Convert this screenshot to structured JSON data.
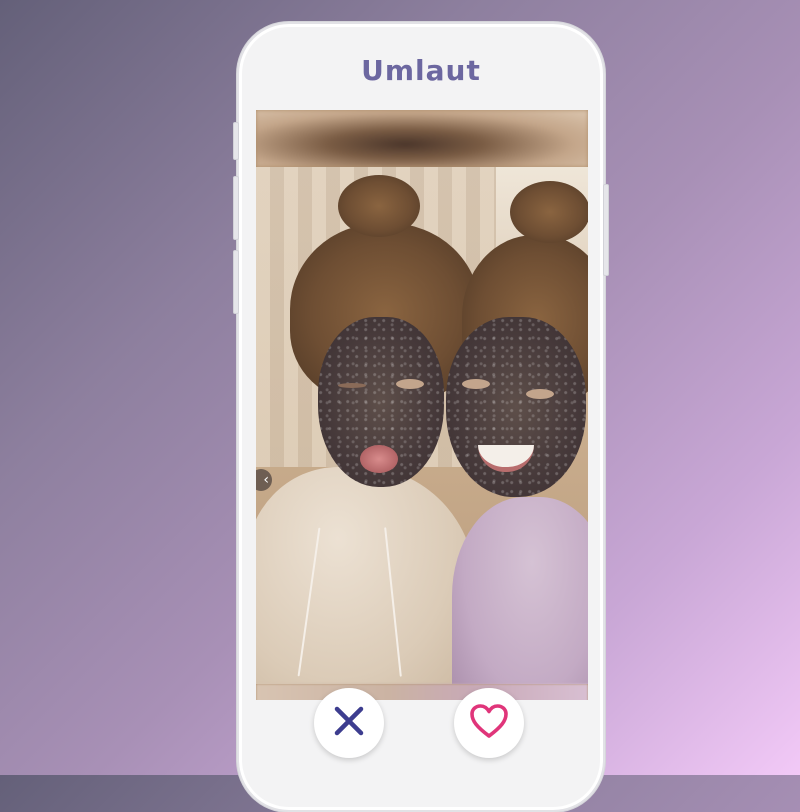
{
  "app": {
    "title": "Umlaut"
  },
  "card": {
    "prev_icon": "chevron-left-icon"
  },
  "actions": {
    "dislike_icon": "close-icon",
    "like_icon": "heart-icon",
    "dislike_color": "#3d3d8f",
    "like_color": "#e0357a"
  },
  "colors": {
    "title": "#6c67a0",
    "phone_frame": "#f3f3f4"
  }
}
